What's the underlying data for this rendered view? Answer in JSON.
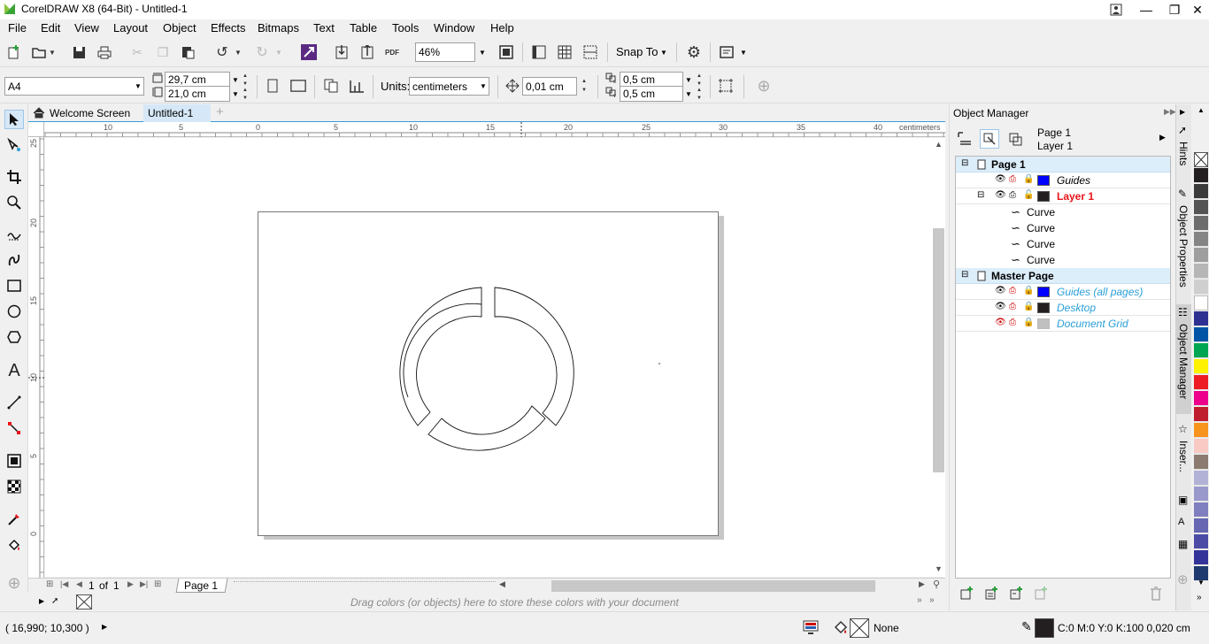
{
  "window": {
    "title": "CorelDRAW X8 (64-Bit) - Untitled-1"
  },
  "menu": [
    "File",
    "Edit",
    "View",
    "Layout",
    "Object",
    "Effects",
    "Bitmaps",
    "Text",
    "Table",
    "Tools",
    "Window",
    "Help"
  ],
  "toolbar1": {
    "zoom_value": "46%",
    "snap_label": "Snap To",
    "pdf_label": "PDF"
  },
  "toolbar2": {
    "page_size": "A4",
    "width": "29,7 cm",
    "height": "21,0 cm",
    "units_label": "Units:",
    "units_value": "centimeters",
    "nudge": "0,01 cm",
    "dup_x": "0,5 cm",
    "dup_y": "0,5 cm"
  },
  "doc_tabs": {
    "welcome": "Welcome Screen",
    "active": "Untitled-1",
    "add": "+"
  },
  "rulers": {
    "h_ticks": [
      "10",
      "5",
      "0",
      "5",
      "10",
      "15",
      "20",
      "25",
      "30",
      "35",
      "40"
    ],
    "h_unit": "centimeters",
    "v_ticks": [
      "25",
      "20",
      "15",
      "10",
      "5",
      "0"
    ]
  },
  "page_nav": {
    "current": "1",
    "of_label": "of",
    "total": "1",
    "page_tab": "Page 1"
  },
  "palette_hint": "Drag colors (or objects) here to store these colors with your document",
  "status": {
    "coords": "( 16,990; 10,300 )",
    "fill_label": "None",
    "outline_info": "C:0 M:0 Y:0 K:100  0,020 cm"
  },
  "object_manager": {
    "title": "Object Manager",
    "header_page": "Page 1",
    "header_layer": "Layer 1",
    "page": {
      "name": "Page 1",
      "guides": "Guides",
      "layer": "Layer 1",
      "objects": [
        "Curve",
        "Curve",
        "Curve",
        "Curve"
      ]
    },
    "master": {
      "name": "Master Page",
      "guides_all": "Guides (all pages)",
      "desktop": "Desktop",
      "grid": "Document Grid"
    },
    "colors": {
      "guides": "#0000ff",
      "layer": "#231f20",
      "layer_text": "#e8141c",
      "master_text": "#2a9fd8",
      "desktop": "#231f20",
      "grid": "#c0c0c0"
    }
  },
  "docker_tabs": [
    "Hints",
    "Object Properties",
    "Object Manager",
    "Inser..."
  ],
  "palette_colors": [
    "#231f20",
    "#3b3b3b",
    "#545454",
    "#6d6d6d",
    "#858585",
    "#9e9e9e",
    "#b6b6b6",
    "#cfcfcf",
    "#ffffff",
    "#2e3192",
    "#0054a6",
    "#00a651",
    "#fff200",
    "#ed1c24",
    "#ec008c",
    "#be1e2d",
    "#f7941d",
    "#f9c9c4",
    "#8c7b70",
    "#b2b2d6",
    "#9999cc",
    "#7f7fbf",
    "#6666b3",
    "#4c4ca6",
    "#333399",
    "#1f3a6e"
  ]
}
